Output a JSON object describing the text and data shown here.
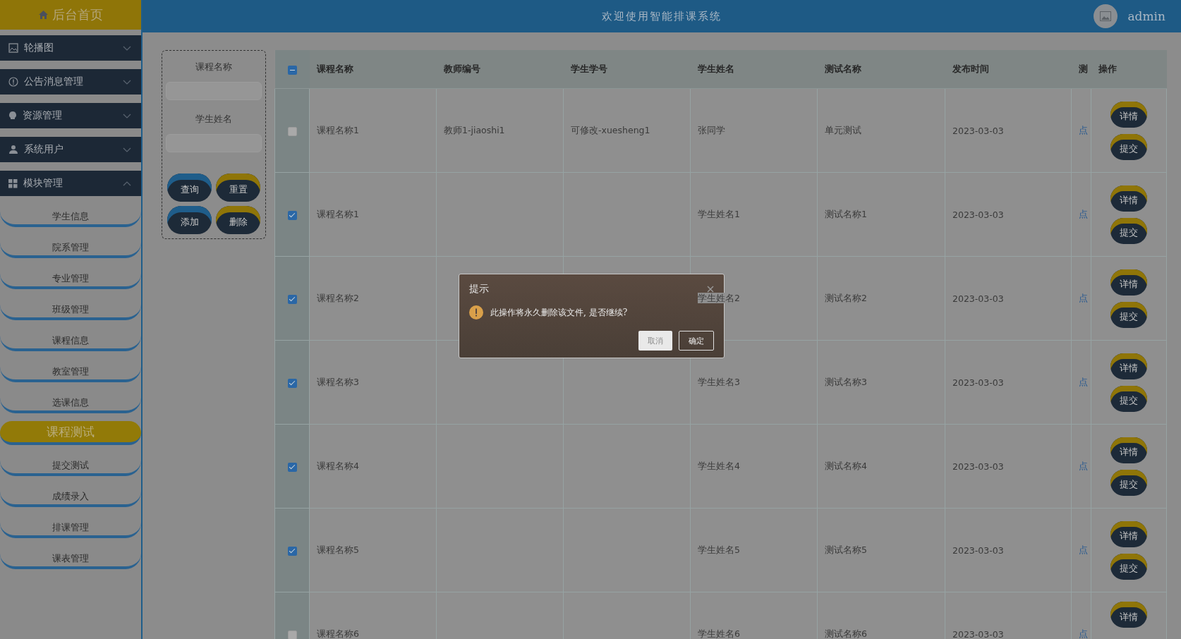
{
  "sidebar": {
    "home": "后台首页",
    "groups": [
      {
        "label": "轮播图",
        "expanded": false
      },
      {
        "label": "公告消息管理",
        "expanded": false
      },
      {
        "label": "资源管理",
        "expanded": false
      },
      {
        "label": "系统用户",
        "expanded": false
      },
      {
        "label": "模块管理",
        "expanded": true,
        "children": [
          {
            "label": "学生信息",
            "selected": false
          },
          {
            "label": "院系管理",
            "selected": false
          },
          {
            "label": "专业管理",
            "selected": false
          },
          {
            "label": "班级管理",
            "selected": false
          },
          {
            "label": "课程信息",
            "selected": false
          },
          {
            "label": "教室管理",
            "selected": false
          },
          {
            "label": "选课信息",
            "selected": false
          },
          {
            "label": "课程测试",
            "selected": true
          },
          {
            "label": "提交测试",
            "selected": false
          },
          {
            "label": "成绩录入",
            "selected": false
          },
          {
            "label": "排课管理",
            "selected": false
          },
          {
            "label": "课表管理",
            "selected": false
          }
        ]
      }
    ]
  },
  "header": {
    "title": "欢迎使用智能排课系统",
    "user": "admin"
  },
  "search": {
    "fields": [
      {
        "label": "课程名称"
      },
      {
        "label": "学生姓名"
      }
    ],
    "buttons": [
      {
        "label": "查询",
        "color": "#1f5d8a"
      },
      {
        "label": "重置",
        "color": "#8f7508"
      },
      {
        "label": "添加",
        "color": "#1f5d8a"
      },
      {
        "label": "删除",
        "color": "#8f7508"
      }
    ]
  },
  "table": {
    "select_all": {
      "indeterminate": true
    },
    "columns": [
      "课程名称",
      "教师编号",
      "学生学号",
      "学生姓名",
      "测试名称",
      "发布时间",
      "测",
      "操作"
    ],
    "rows": [
      {
        "checked": false,
        "course": "课程名称1",
        "teacher_no": "教师1-jiaoshi1",
        "student_no": "可修改-xuesheng1",
        "student_name": "张同学",
        "test_name": "单元测试",
        "date": "2023-03-03",
        "link": "点",
        "actions": [
          "详情",
          "提交"
        ]
      },
      {
        "checked": true,
        "course": "课程名称1",
        "student_name": "学生姓名1",
        "test_name": "测试名称1",
        "date": "2023-03-03",
        "link": "点",
        "actions": [
          "详情",
          "提交"
        ]
      },
      {
        "checked": true,
        "course": "课程名称2",
        "student_name": "学生姓名2",
        "test_name": "测试名称2",
        "date": "2023-03-03",
        "link": "点",
        "actions": [
          "详情",
          "提交"
        ]
      },
      {
        "checked": true,
        "course": "课程名称3",
        "student_name": "学生姓名3",
        "test_name": "测试名称3",
        "date": "2023-03-03",
        "link": "点",
        "actions": [
          "详情",
          "提交"
        ]
      },
      {
        "checked": true,
        "course": "课程名称4",
        "student_name": "学生姓名4",
        "test_name": "测试名称4",
        "date": "2023-03-03",
        "link": "点",
        "actions": [
          "详情",
          "提交"
        ]
      },
      {
        "checked": true,
        "course": "课程名称5",
        "student_name": "学生姓名5",
        "test_name": "测试名称5",
        "date": "2023-03-03",
        "link": "点",
        "actions": [
          "详情",
          "提交"
        ]
      },
      {
        "checked": false,
        "course": "课程名称6",
        "student_name": "学生姓名6",
        "test_name": "测试名称6",
        "date": "2023-03-03",
        "link": "点",
        "actions": [
          "详情"
        ]
      }
    ]
  },
  "dialog": {
    "title": "提示",
    "message": "此操作将永久删除该文件, 是否继续?",
    "buttons": [
      {
        "label": "取消",
        "kind": "cancel"
      },
      {
        "label": "确定",
        "kind": "confirm"
      }
    ]
  }
}
